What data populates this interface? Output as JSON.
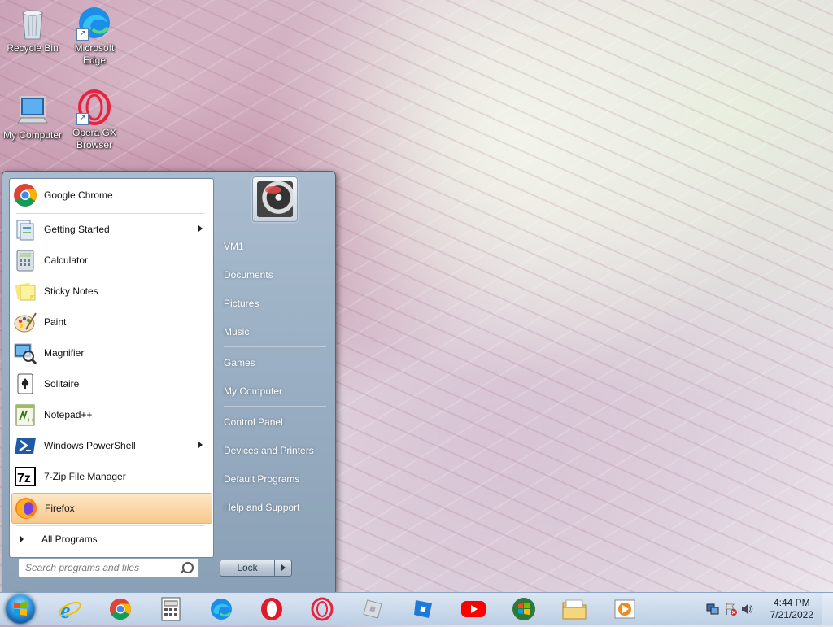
{
  "desktop": {
    "icons": [
      {
        "label": "Recycle Bin"
      },
      {
        "label": "Microsoft Edge"
      },
      {
        "label": "My Computer"
      },
      {
        "label": "Opera GX Browser"
      }
    ]
  },
  "start_menu": {
    "pinned": [
      {
        "label": "Google Chrome",
        "icon": "chrome-icon"
      },
      {
        "label": "Getting Started",
        "icon": "getting-started-icon",
        "submenu": true
      },
      {
        "label": "Calculator",
        "icon": "calculator-icon"
      },
      {
        "label": "Sticky Notes",
        "icon": "sticky-notes-icon"
      },
      {
        "label": "Paint",
        "icon": "paint-icon"
      },
      {
        "label": "Magnifier",
        "icon": "magnifier-icon"
      },
      {
        "label": "Solitaire",
        "icon": "solitaire-icon"
      },
      {
        "label": "Notepad++",
        "icon": "notepad-plus-plus-icon"
      },
      {
        "label": "Windows PowerShell",
        "icon": "powershell-icon",
        "submenu": true
      },
      {
        "label": "7-Zip File Manager",
        "icon": "seven-zip-icon"
      },
      {
        "label": "Firefox",
        "icon": "firefox-icon",
        "highlighted": true
      }
    ],
    "all_programs": "All Programs",
    "search": {
      "placeholder": "Search programs and files"
    },
    "right": {
      "user": "VM1",
      "documents": "Documents",
      "pictures": "Pictures",
      "music": "Music",
      "games": "Games",
      "computer": "My Computer",
      "control_panel": "Control Panel",
      "devices": "Devices and Printers",
      "defaults": "Default Programs",
      "help": "Help and Support"
    },
    "lock": "Lock"
  },
  "taskbar": {
    "clock": {
      "time": "4:44 PM",
      "date": "7/21/2022"
    },
    "pinned": [
      "ie-icon",
      "chrome-icon",
      "calculator-app-icon",
      "edge-icon",
      "opera-icon",
      "opera-gx-icon",
      "roblox-icon",
      "roblox-studio-icon",
      "youtube-icon",
      "windows-logo-icon",
      "file-explorer-icon",
      "media-player-icon"
    ]
  },
  "colors": {
    "accent": "#2d8fd8",
    "highlight": "#f8c88c"
  }
}
